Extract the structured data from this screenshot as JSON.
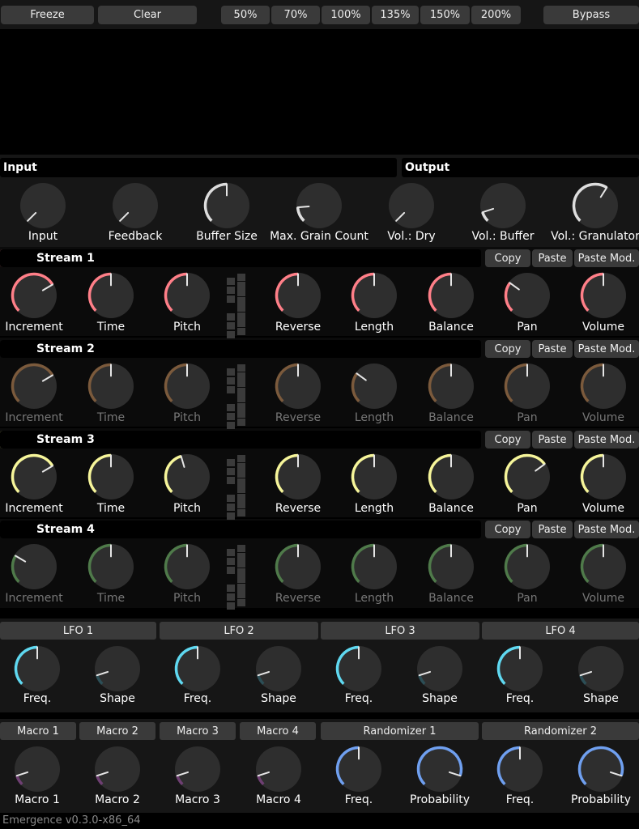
{
  "toolbar": {
    "freeze": "Freeze",
    "clear": "Clear",
    "zoom": [
      "50%",
      "70%",
      "100%",
      "135%",
      "150%",
      "200%"
    ],
    "bypass": "Bypass"
  },
  "io": {
    "input_label": "Input",
    "output_label": "Output",
    "knobs": [
      {
        "label": "Input",
        "value": 0.0
      },
      {
        "label": "Feedback",
        "value": 0.0
      },
      {
        "label": "Buffer Size",
        "value": 0.5
      },
      {
        "label": "Max. Grain Count",
        "value": 0.15
      },
      {
        "label": "Vol.: Dry",
        "value": 0.0
      },
      {
        "label": "Vol.: Buffer",
        "value": 0.1
      },
      {
        "label": "Vol.: Granulator",
        "value": 0.62
      }
    ]
  },
  "stream_buttons": {
    "copy": "Copy",
    "paste": "Paste",
    "paste_mod": "Paste Mod."
  },
  "streams": [
    {
      "name": "Stream 1",
      "active": true,
      "color": "#ff7f88",
      "swatch": "#ff7f88",
      "knobs": [
        {
          "label": "Increment",
          "value": 0.72
        },
        {
          "label": "Time",
          "value": 0.5
        },
        {
          "label": "Pitch",
          "value": 0.5
        },
        {
          "label": "Reverse",
          "value": 0.5
        },
        {
          "label": "Length",
          "value": 0.5
        },
        {
          "label": "Balance",
          "value": 0.5
        },
        {
          "label": "Pan",
          "value": 0.3
        },
        {
          "label": "Volume",
          "value": 0.5
        }
      ]
    },
    {
      "name": "Stream 2",
      "active": false,
      "color": "#7b5a3c",
      "swatch": "#333333",
      "knobs": [
        {
          "label": "Increment",
          "value": 0.72
        },
        {
          "label": "Time",
          "value": 0.5
        },
        {
          "label": "Pitch",
          "value": 0.5
        },
        {
          "label": "Reverse",
          "value": 0.5
        },
        {
          "label": "Length",
          "value": 0.3
        },
        {
          "label": "Balance",
          "value": 0.5
        },
        {
          "label": "Pan",
          "value": 0.5
        },
        {
          "label": "Volume",
          "value": 0.5
        }
      ]
    },
    {
      "name": "Stream 3",
      "active": true,
      "color": "#f6f59a",
      "swatch": "#fbfb9e",
      "knobs": [
        {
          "label": "Increment",
          "value": 0.72
        },
        {
          "label": "Time",
          "value": 0.5
        },
        {
          "label": "Pitch",
          "value": 0.44
        },
        {
          "label": "Reverse",
          "value": 0.5
        },
        {
          "label": "Length",
          "value": 0.5
        },
        {
          "label": "Balance",
          "value": 0.5
        },
        {
          "label": "Pan",
          "value": 0.7
        },
        {
          "label": "Volume",
          "value": 0.5
        }
      ]
    },
    {
      "name": "Stream 4",
      "active": false,
      "color": "#4f7a4a",
      "swatch": "#333333",
      "knobs": [
        {
          "label": "Increment",
          "value": 0.28
        },
        {
          "label": "Time",
          "value": 0.5
        },
        {
          "label": "Pitch",
          "value": 0.5
        },
        {
          "label": "Reverse",
          "value": 0.5
        },
        {
          "label": "Length",
          "value": 0.5
        },
        {
          "label": "Balance",
          "value": 0.5
        },
        {
          "label": "Pan",
          "value": 0.5
        },
        {
          "label": "Volume",
          "value": 0.5
        }
      ]
    }
  ],
  "lfos": [
    {
      "name": "LFO 1",
      "knobs": [
        {
          "label": "Freq.",
          "value": 0.5
        },
        {
          "label": "Shape",
          "value": 0.1
        }
      ]
    },
    {
      "name": "LFO 2",
      "knobs": [
        {
          "label": "Freq.",
          "value": 0.5
        },
        {
          "label": "Shape",
          "value": 0.1
        }
      ]
    },
    {
      "name": "LFO 3",
      "knobs": [
        {
          "label": "Freq.",
          "value": 0.5
        },
        {
          "label": "Shape",
          "value": 0.1
        }
      ]
    },
    {
      "name": "LFO 4",
      "knobs": [
        {
          "label": "Freq.",
          "value": 0.5
        },
        {
          "label": "Shape",
          "value": 0.1
        }
      ]
    }
  ],
  "macros": [
    {
      "name": "Macro 1",
      "value": 0.1
    },
    {
      "name": "Macro 2",
      "value": 0.1
    },
    {
      "name": "Macro 3",
      "value": 0.1
    },
    {
      "name": "Macro 4",
      "value": 0.1
    }
  ],
  "randomizers": [
    {
      "name": "Randomizer 1",
      "knobs": [
        {
          "label": "Freq.",
          "value": 0.5
        },
        {
          "label": "Probability",
          "value": 0.9
        }
      ]
    },
    {
      "name": "Randomizer 2",
      "knobs": [
        {
          "label": "Freq.",
          "value": 0.5
        },
        {
          "label": "Probability",
          "value": 0.9
        }
      ]
    }
  ],
  "colors": {
    "input_knob": "#dddddd",
    "lfo_knob": "#5fd8f0",
    "macro_knob": "#6e3f72",
    "random_knob": "#6f9fef",
    "knob_face": "#2e2e2e",
    "button": "#3a3a3a"
  },
  "footer": "Emergence v0.3.0-x86_64"
}
